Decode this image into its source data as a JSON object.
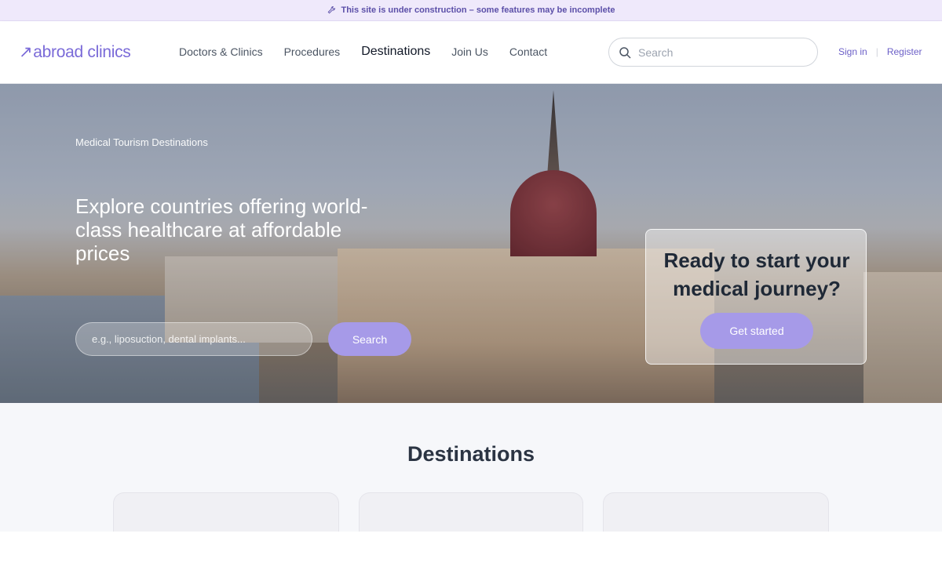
{
  "banner": {
    "text": "This site is under construction – some features may be incomplete",
    "icon": "wrench-icon"
  },
  "header": {
    "logo": {
      "mark": "↗",
      "text": "abroad clinics"
    },
    "nav": [
      {
        "label": "Doctors & Clinics",
        "active": false
      },
      {
        "label": "Procedures",
        "active": false
      },
      {
        "label": "Destinations",
        "active": true
      },
      {
        "label": "Join Us",
        "active": false
      },
      {
        "label": "Contact",
        "active": false
      }
    ],
    "search": {
      "placeholder": "Search",
      "icon": "search-icon"
    },
    "auth": {
      "sign_in": "Sign in",
      "separator": "|",
      "register": "Register"
    }
  },
  "hero": {
    "eyebrow": "Medical Tourism Destinations",
    "title": "Explore countries offering world-class healthcare at affordable prices",
    "search_placeholder": "e.g., liposuction, dental implants...",
    "search_button": "Search"
  },
  "cta": {
    "title": "Ready to start your medical journey?",
    "button": "Get started"
  },
  "destinations": {
    "title": "Destinations"
  },
  "colors": {
    "accent": "#a69ae8",
    "brand": "#7a6ad8",
    "banner_bg": "#efe9fb"
  }
}
